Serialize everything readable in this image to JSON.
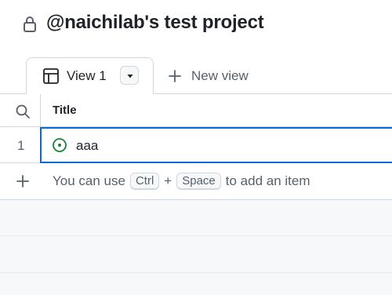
{
  "project": {
    "title": "@naichilab's test project",
    "icon": "lock-icon"
  },
  "tabs": {
    "active_label": "View 1",
    "active_icon": "table-icon",
    "new_view_label": "New view"
  },
  "table": {
    "columns": [
      "Title"
    ],
    "rows": [
      {
        "number": "1",
        "title": "aaa",
        "status_icon": "open-issue-icon"
      }
    ]
  },
  "add_hint": {
    "prefix": "You can use",
    "key1": "Ctrl",
    "plus": "+",
    "key2": "Space",
    "suffix": "to add an item"
  },
  "colors": {
    "accent": "#0969da",
    "status_open": "#1a7f37"
  }
}
